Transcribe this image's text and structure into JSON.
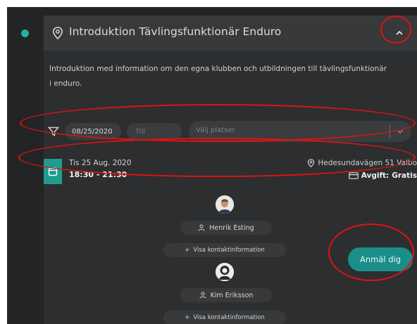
{
  "event": {
    "title": "Introduktion Tävlingsfunktionär Enduro",
    "description": "Introduktion med information om den egna klubben och utbildningen till tävlingsfunktionär i enduro."
  },
  "filter": {
    "date_from": "08/25/2020",
    "date_to_placeholder": "Till",
    "place_placeholder": "Välj platser"
  },
  "occasion": {
    "day": "Tis 25 Aug. 2020",
    "time": "18:30 - 21:30",
    "address": "Hedesundavägen 51 Valbo",
    "fee_label": "Avgift:",
    "fee_value": "Gratis"
  },
  "contacts": [
    {
      "name": "Henrik Esting",
      "info_label": "Visa kontaktinformation"
    },
    {
      "name": "Kim Eriksson",
      "info_label": "Visa kontaktinformation"
    }
  ],
  "actions": {
    "signup_label": "Anmäl dig"
  },
  "icons": {
    "header": "map-pin-icon",
    "collapse": "chevron-up-icon",
    "filter": "funnel-icon",
    "select": "chevron-down-icon",
    "date": "calendar-icon",
    "address": "map-pin-icon",
    "fee": "credit-card-icon",
    "contact": "person-icon",
    "info": "plus-icon"
  },
  "colors": {
    "accent": "#1f9c8f",
    "button": "#1a8f8a",
    "annotation": "#e01212",
    "background": "#2d2e30"
  }
}
